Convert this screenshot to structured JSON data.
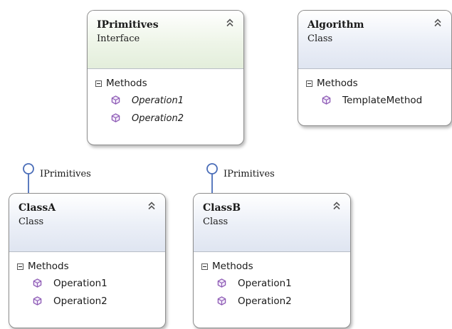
{
  "boxes": {
    "iprimitives": {
      "name": "IPrimitives",
      "kind": "Interface",
      "group": "Methods",
      "methods": [
        "Operation1",
        "Operation2"
      ]
    },
    "algorithm": {
      "name": "Algorithm",
      "kind": "Class",
      "group": "Methods",
      "methods": [
        "TemplateMethod"
      ]
    },
    "classA": {
      "name": "ClassA",
      "kind": "Class",
      "group": "Methods",
      "methods": [
        "Operation1",
        "Operation2"
      ],
      "implements": "IPrimitives"
    },
    "classB": {
      "name": "ClassB",
      "kind": "Class",
      "group": "Methods",
      "methods": [
        "Operation1",
        "Operation2"
      ],
      "implements": "IPrimitives"
    }
  },
  "icons": {
    "collapse": "double-chevron-up-icon",
    "group": "minus-square-icon",
    "method": "method-cube-icon",
    "lollipop": "interface-lollipop-icon"
  },
  "colors": {
    "interface_header": "#e3eedb",
    "class_header": "#dfe5f1",
    "method_icon": "#8e5bb5",
    "lollipop": "#4a6db8",
    "border": "#8e8e8e"
  }
}
